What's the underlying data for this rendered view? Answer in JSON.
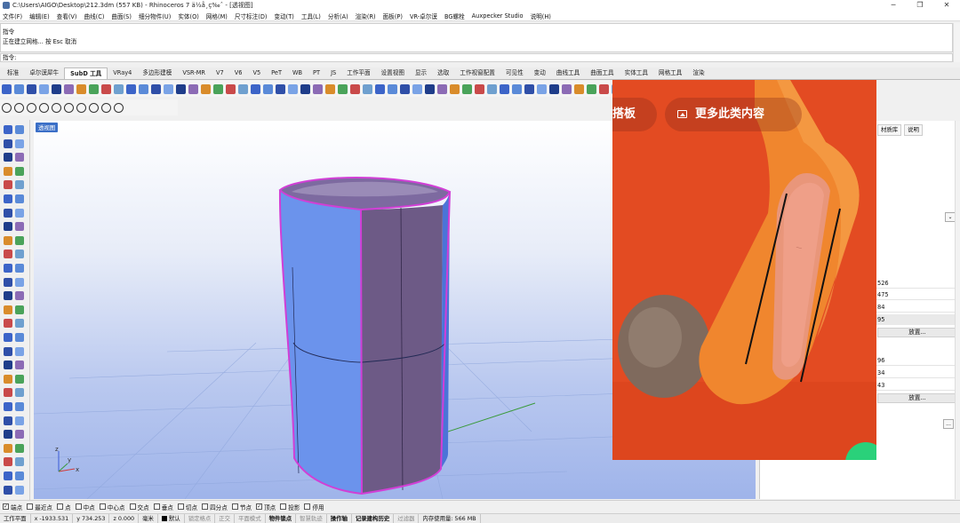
{
  "window": {
    "title": "C:\\Users\\AIGO\\Desktop\\212.3dm (557 KB) - Rhinoceros 7 ä½å¸ç‰ˆ - [透视图]",
    "controls": [
      "─",
      "❐",
      "✕"
    ]
  },
  "menu": [
    "文件(F)",
    "编辑(E)",
    "查看(V)",
    "曲线(C)",
    "曲面(S)",
    "细分物件(U)",
    "实体(O)",
    "网格(M)",
    "尺寸标注(D)",
    "变动(T)",
    "工具(L)",
    "分析(A)",
    "渲染(R)",
    "面板(P)",
    "VR-卓尔谟",
    "BG螺栓",
    "Auxpecker Studio",
    "说明(H)"
  ],
  "command": {
    "history": [
      "指令",
      "正在建立网格... 按 Esc 取消"
    ],
    "prompt": "指令:"
  },
  "tabs": {
    "items": [
      "标准",
      "卓尔谟犀牛",
      "SubD 工具",
      "VRay4",
      "多边形建模",
      "VSR-MR",
      "V7",
      "V6",
      "V5",
      "PeT",
      "WB",
      "PT",
      "JS",
      "工作平面",
      "设置视图",
      "显示",
      "选取",
      "工作视窗配置",
      "可见性",
      "变动",
      "曲线工具",
      "曲面工具",
      "实体工具",
      "网格工具",
      "渲染"
    ],
    "active_index": 2
  },
  "viewport": {
    "label": "透视图",
    "axis_labels": {
      "x": "x",
      "y": "y",
      "z": "z"
    }
  },
  "overlay": {
    "left_button": "搭板",
    "right_button": "更多此类内容",
    "button_icon": "image-icon"
  },
  "right_panel": {
    "tabs": [
      "材质库",
      "说明"
    ],
    "values": [
      "526",
      "475",
      "84",
      "95",
      "96",
      "34",
      "43"
    ],
    "button_label": "放置...",
    "ellipsis": "..."
  },
  "osnaps": [
    {
      "label": "端点",
      "checked": true
    },
    {
      "label": "最近点",
      "checked": false
    },
    {
      "label": "点",
      "checked": false
    },
    {
      "label": "中点",
      "checked": false
    },
    {
      "label": "中心点",
      "checked": false
    },
    {
      "label": "交点",
      "checked": false
    },
    {
      "label": "垂点",
      "checked": false
    },
    {
      "label": "切点",
      "checked": false
    },
    {
      "label": "四分点",
      "checked": false
    },
    {
      "label": "节点",
      "checked": false
    },
    {
      "label": "顶点",
      "checked": true
    },
    {
      "label": "投影",
      "checked": false
    },
    {
      "label": "停用",
      "checked": false
    }
  ],
  "status": {
    "cplane": "工作平面",
    "x": "x -1933.531",
    "y": "y 734.253",
    "z": "z 0.000",
    "units": "毫米",
    "layer": "默认",
    "toggles": [
      "锁定格点",
      "正交",
      "平面模式",
      "物件锁点",
      "智慧轨迹",
      "操作轴",
      "记录建构历史",
      "过滤器"
    ],
    "memory": "内存使用量: 566 MB"
  },
  "colors": {
    "accent": "#3b6fc7",
    "overlay_bg": "#e34b22",
    "object_edge": "#d13fd6",
    "cylinder_front": "#6b93ec",
    "cylinder_side": "#6d5a86",
    "fab": "#2ad17a"
  }
}
